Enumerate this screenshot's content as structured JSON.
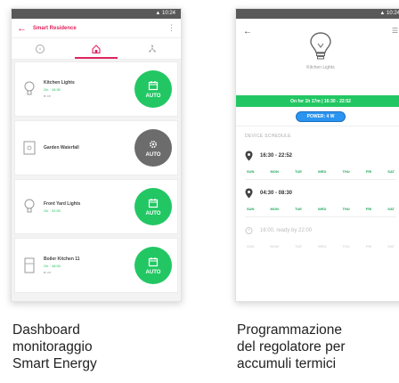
{
  "left_phone": {
    "status_time": "▲ 10:24",
    "app_title": "Smart Residence",
    "devices": [
      {
        "name": "Kitchen Lights",
        "line1": "On · 16:30",
        "line2": "● on",
        "mode": "AUTO",
        "state": "on"
      },
      {
        "name": "Garden Waterfall",
        "line1": "",
        "line2": "",
        "mode": "AUTO",
        "state": "off"
      },
      {
        "name": "Front Yard Lights",
        "line1": "On · 22:00",
        "line2": "",
        "mode": "AUTO",
        "state": "on"
      },
      {
        "name": "Boiler Kitchen 11",
        "line1": "On · 18:00",
        "line2": "● on",
        "mode": "AUTO",
        "state": "on"
      }
    ]
  },
  "right_phone": {
    "status_time": "▲ 10:24",
    "device_name": "Kitchen Lights",
    "status_bar": "On for 1h 17m  |  16:30 - 22:52",
    "power_pill": "POWER: 4 W",
    "section_title": "DEVICE SCHEDULE",
    "schedules": [
      {
        "time": "16:30 - 22:52",
        "days": [
          "SUN",
          "MON",
          "TUE",
          "WED",
          "THU",
          "FRI",
          "SAT"
        ],
        "muted": false
      },
      {
        "time": "04:30 - 08:30",
        "days": [
          "SUN",
          "MON",
          "TUE",
          "WED",
          "THU",
          "FRI",
          "SAT"
        ],
        "muted": false
      },
      {
        "time": "16:00, ready by 22:00",
        "days": [
          "SUN",
          "MON",
          "TUE",
          "WED",
          "THU",
          "FRI",
          "SAT"
        ],
        "muted": true
      }
    ]
  },
  "captions": {
    "left": [
      "Dashboard",
      "monitoraggio",
      "Smart Energy"
    ],
    "right": [
      "Programmazione",
      "del regolatore per",
      "accumuli termici"
    ]
  },
  "colors": {
    "accent": "#e0245e",
    "green": "#22c763",
    "grey_button": "#6c6c6c",
    "blue": "#2a94f0"
  }
}
